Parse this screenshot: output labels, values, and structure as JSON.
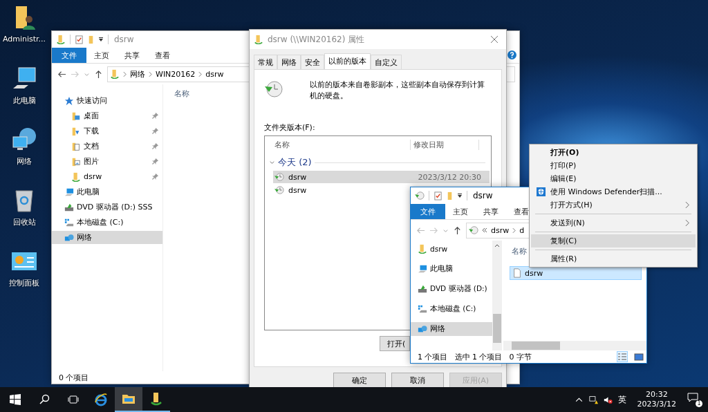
{
  "desktop_icons": [
    {
      "label": "Administr...",
      "kind": "user-folder"
    },
    {
      "label": "此电脑",
      "kind": "computer"
    },
    {
      "label": "网络",
      "kind": "network"
    },
    {
      "label": "回收站",
      "kind": "recycle-bin"
    },
    {
      "label": "控制面板",
      "kind": "control-panel"
    }
  ],
  "explorer_main": {
    "title": "dsrw",
    "ribbon_tabs": [
      {
        "label": "文件",
        "kind": "file-menu"
      },
      {
        "label": "主页",
        "kind": "tab"
      },
      {
        "label": "共享",
        "kind": "tab"
      },
      {
        "label": "查看",
        "kind": "tab"
      }
    ],
    "address_path": [
      "网络",
      "WIN20162",
      "dsrw"
    ],
    "column_header": "名称",
    "nav": [
      {
        "label": "快速访问",
        "kind": "star",
        "selected": false,
        "children": [
          {
            "label": "桌面",
            "kind": "folder",
            "pinned": true,
            "selected": false
          },
          {
            "label": "下载",
            "kind": "download",
            "pinned": true,
            "selected": false
          },
          {
            "label": "文档",
            "kind": "document",
            "pinned": true,
            "selected": false
          },
          {
            "label": "图片",
            "kind": "picture",
            "pinned": true,
            "selected": false
          },
          {
            "label": "dsrw",
            "kind": "share",
            "pinned": true,
            "selected": false
          }
        ]
      },
      {
        "label": "此电脑",
        "kind": "computer",
        "selected": false
      },
      {
        "label": "DVD 驱动器 (D:) SSS",
        "kind": "dvd",
        "selected": false
      },
      {
        "label": "本地磁盘 (C:)",
        "kind": "disk",
        "selected": false
      },
      {
        "label": "网络",
        "kind": "network",
        "selected": true
      }
    ],
    "status": "0 个项目"
  },
  "properties_dialog": {
    "title": "dsrw (\\\\WIN20162) 属性",
    "tabs": [
      {
        "label": "常规",
        "selected": false
      },
      {
        "label": "网络",
        "selected": false
      },
      {
        "label": "安全",
        "selected": false
      },
      {
        "label": "以前的版本",
        "selected": true
      },
      {
        "label": "自定义",
        "selected": false
      }
    ],
    "description": "以前的版本来自卷影副本，这些副本自动保存到计算机的硬盘。",
    "list_label": "文件夹版本(F):",
    "columns": [
      "名称",
      "修改日期"
    ],
    "group": {
      "label": "今天 (2)",
      "expanded": true
    },
    "versions": [
      {
        "name": "dsrw",
        "date": "2023/3/12 20:30",
        "selected": true
      },
      {
        "name": "dsrw",
        "selected": false
      }
    ],
    "open_button": "打开(",
    "buttons": [
      {
        "label": "确定",
        "disabled": false
      },
      {
        "label": "取消",
        "disabled": false
      },
      {
        "label": "应用(A)",
        "disabled": true
      }
    ]
  },
  "explorer_copy": {
    "title": "dsrw",
    "ribbon_tabs": [
      {
        "label": "文件",
        "kind": "file-menu"
      },
      {
        "label": "主页",
        "kind": "tab"
      },
      {
        "label": "共享",
        "kind": "tab"
      },
      {
        "label": "查看",
        "kind": "tab"
      }
    ],
    "address_path": [
      "dsrw",
      "d"
    ],
    "nav": [
      {
        "label": "dsrw",
        "kind": "share",
        "selected": false
      },
      {
        "label": "此电脑",
        "kind": "computer",
        "selected": false
      },
      {
        "label": "DVD 驱动器 (D:)",
        "kind": "dvd",
        "selected": false
      },
      {
        "label": "本地磁盘 (C:)",
        "kind": "disk",
        "selected": false
      },
      {
        "label": "网络",
        "kind": "network",
        "selected": true
      }
    ],
    "column_header": "名称",
    "files": [
      {
        "name": "dsrw",
        "selected": true
      }
    ],
    "status": [
      "1 个项目",
      "选中 1 个项目",
      "0 字节"
    ]
  },
  "context_menu": [
    {
      "kind": "item",
      "label": "打开(O)",
      "bold": true,
      "submenu": false,
      "selected": false
    },
    {
      "kind": "item",
      "label": "打印(P)",
      "bold": false,
      "submenu": false,
      "selected": false
    },
    {
      "kind": "item",
      "label": "编辑(E)",
      "bold": false,
      "submenu": false,
      "selected": false
    },
    {
      "kind": "scan-item",
      "label": "使用 Windows Defender扫描...",
      "bold": false,
      "submenu": false,
      "selected": false
    },
    {
      "kind": "item",
      "label": "打开方式(H)",
      "bold": false,
      "submenu": true,
      "selected": false
    },
    {
      "kind": "separator"
    },
    {
      "kind": "item",
      "label": "发送到(N)",
      "bold": false,
      "submenu": true,
      "selected": false
    },
    {
      "kind": "separator"
    },
    {
      "kind": "item",
      "label": "复制(C)",
      "bold": false,
      "submenu": false,
      "selected": true
    },
    {
      "kind": "separator"
    },
    {
      "kind": "item",
      "label": "属性(R)",
      "bold": false,
      "submenu": false,
      "selected": false
    }
  ],
  "taskbar": {
    "apps": [
      {
        "kind": "browser",
        "running": false,
        "active": false
      },
      {
        "kind": "explorer",
        "running": true,
        "active": true
      },
      {
        "kind": "share-app",
        "running": true,
        "active": false
      }
    ],
    "ime": "英",
    "time": "20:32",
    "date": "2023/3/12",
    "notifications": "1"
  }
}
